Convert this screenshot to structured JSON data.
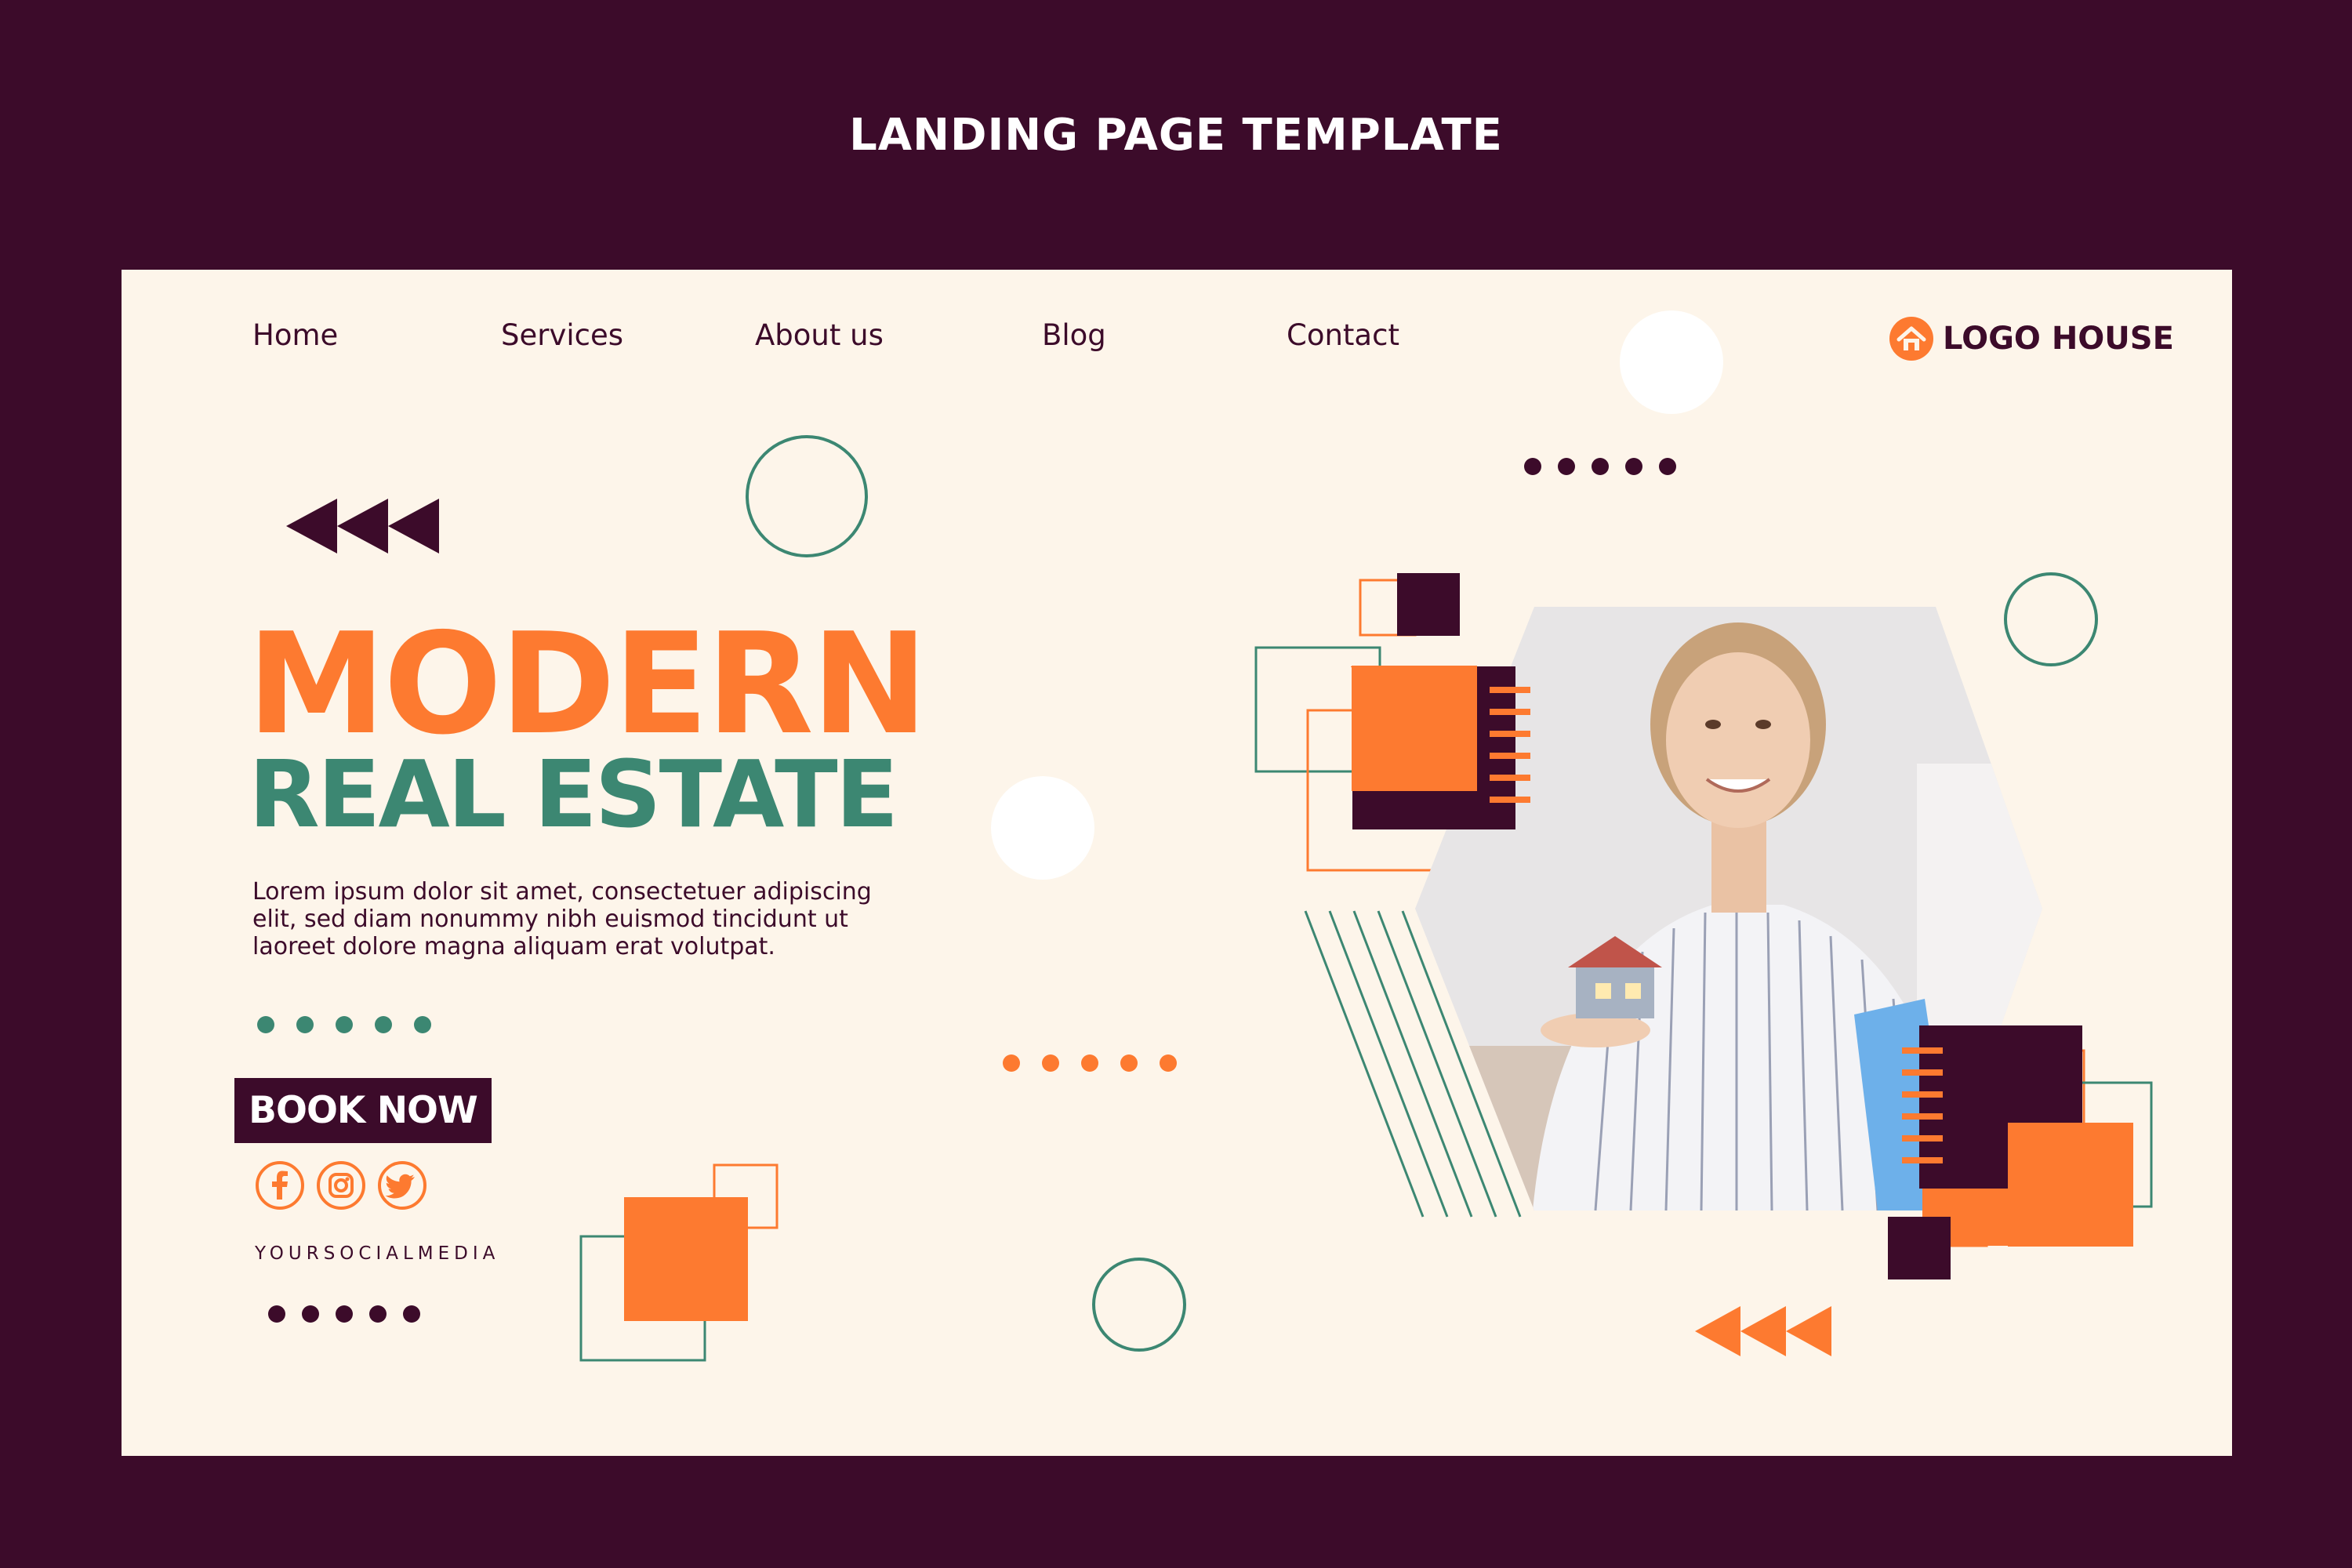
{
  "banner": {
    "title": "LANDING PAGE TEMPLATE"
  },
  "nav": {
    "items": [
      {
        "label": "Home"
      },
      {
        "label": "Services"
      },
      {
        "label": "About us"
      },
      {
        "label": "Blog"
      },
      {
        "label": "Contact"
      }
    ]
  },
  "logo": {
    "text": "LOGO HOUSE",
    "icon": "house-icon"
  },
  "hero": {
    "headline_line1": "MODERN",
    "headline_line2": "REAL ESTATE",
    "body": "Lorem ipsum dolor sit amet, consectetuer adipiscing elit, sed diam nonummy nibh euismod tincidunt ut laoreet dolore magna aliquam erat volutpat.",
    "cta_label": "BOOK NOW",
    "image": "photo of smiling woman holding a small house model and a blue folder"
  },
  "social": {
    "icons": [
      "facebook-icon",
      "instagram-icon",
      "twitter-icon"
    ],
    "handle": "YOURSOCIALMEDIA"
  },
  "colors": {
    "background": "#3c0b2a",
    "card": "#fdf5ea",
    "orange": "#fd7a30",
    "green": "#3c8772",
    "plum": "#3c0b2a"
  }
}
